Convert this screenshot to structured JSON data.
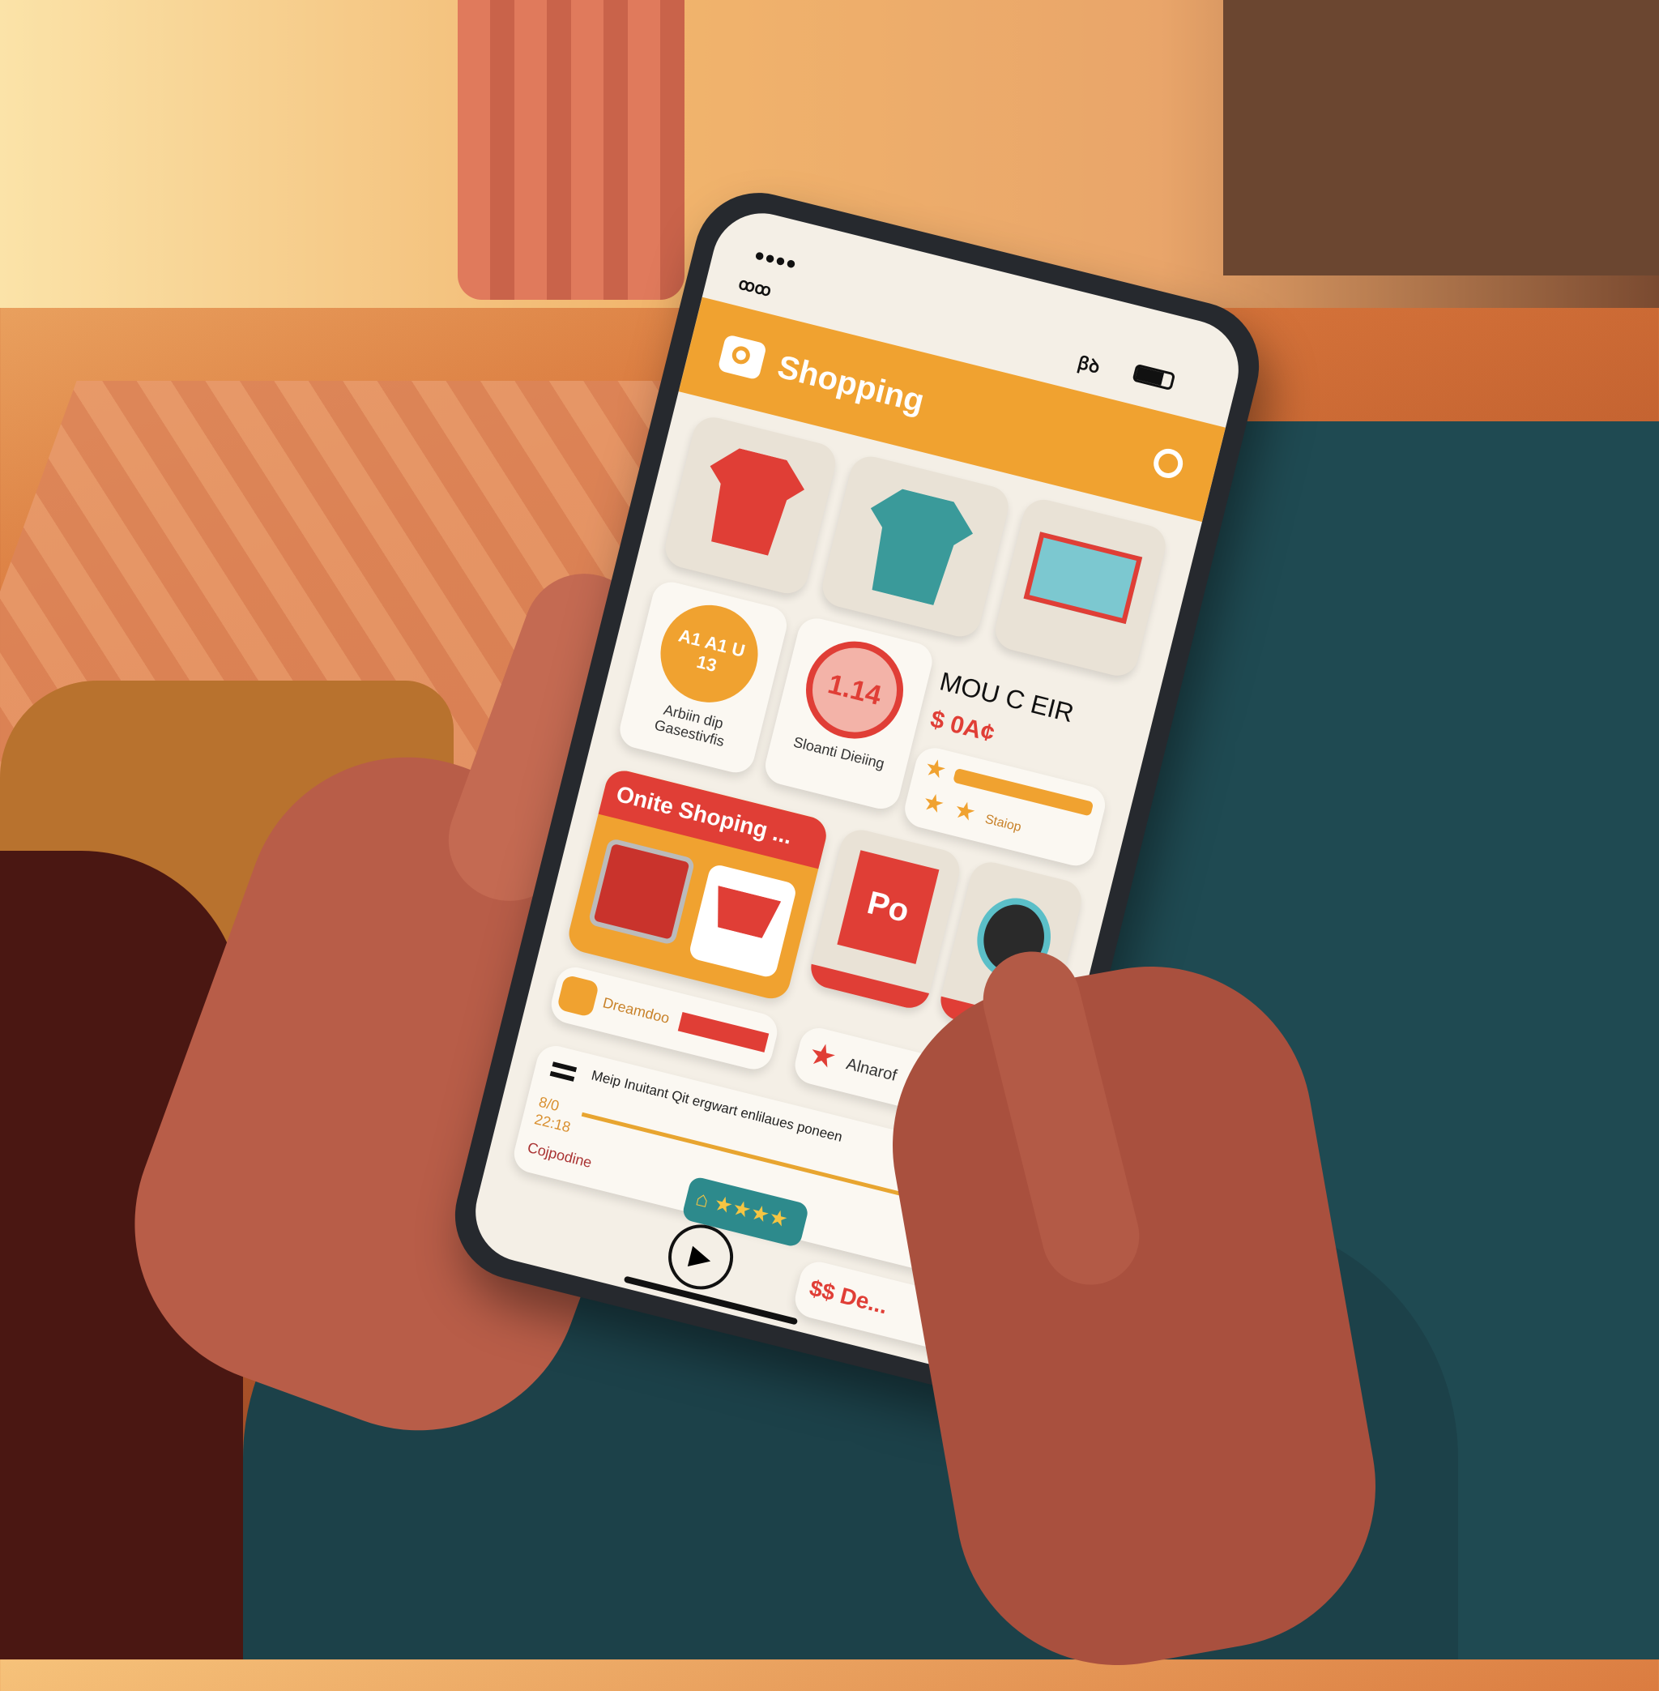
{
  "status_bar": {
    "signal_dots": "●●●●",
    "carrier_glyph": "ꝏ",
    "network": "ꞵꝺ",
    "left_icon": "ꝏꝏ"
  },
  "header": {
    "title": "Shopping",
    "camera_icon": "camera-icon",
    "search_icon": "search-icon"
  },
  "categories": [
    {
      "name": "red-shirt"
    },
    {
      "name": "teal-shirt"
    },
    {
      "name": "monitor"
    }
  ],
  "badges": [
    {
      "circle_text": "A1 A1 U 13",
      "label": "Arbiin dip Gasestivfis"
    },
    {
      "circle_text": "1.14",
      "label": "Sloanti Dieiing"
    }
  ],
  "product": {
    "title": "MOU C EIR",
    "price": "$ 0A¢",
    "rating_label": "Staiop"
  },
  "promo": {
    "title": "Onite Shoping ...",
    "po_label": "Po"
  },
  "row4": {
    "profile_label": "Dreamdoo",
    "favorite_label": "Alnarof"
  },
  "info_card": {
    "text": "Meip Inuitant Qit ergwart enlilaues poneen",
    "date": "8/0",
    "time": "22:18",
    "link": "Cojpodine",
    "stars": 4,
    "price": "$$ De..."
  },
  "colors": {
    "orange": "#f0a230",
    "red": "#e03e36",
    "teal": "#2d8a8c",
    "screen": "#f4efe6"
  }
}
